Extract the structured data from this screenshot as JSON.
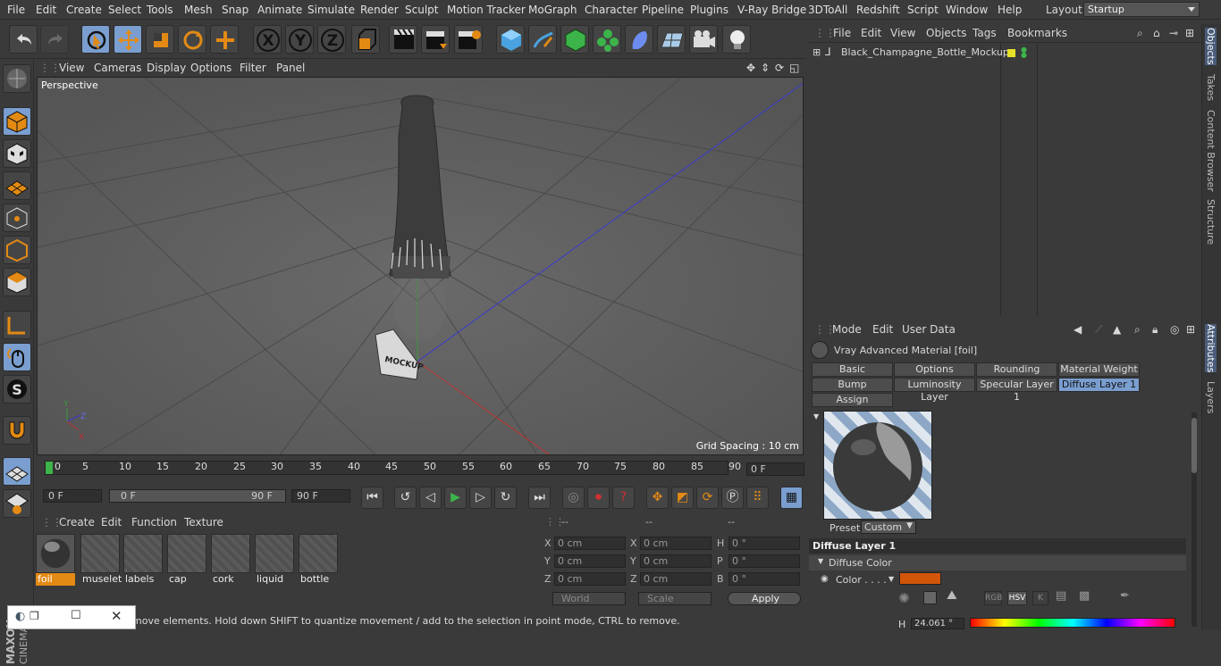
{
  "menu": [
    "File",
    "Edit",
    "Create",
    "Select",
    "Tools",
    "Mesh",
    "Snap",
    "Animate",
    "Simulate",
    "Render",
    "Sculpt",
    "Motion Tracker",
    "MoGraph",
    "Character",
    "Pipeline",
    "Plugins",
    "V-Ray Bridge",
    "3DToAll",
    "Redshift",
    "Script",
    "Window",
    "Help"
  ],
  "layout": {
    "label": "Layout:",
    "value": "Startup"
  },
  "toolbar_icons": [
    "undo-icon",
    "redo-icon",
    "live-selection-icon",
    "move-icon",
    "scale-icon",
    "rotate-icon",
    "last-tool-icon",
    "x-axis-icon",
    "y-axis-icon",
    "z-axis-icon",
    "coordinate-system-icon",
    "render-view-icon",
    "render-picture-viewer-icon",
    "edit-render-settings-icon",
    "cube-icon",
    "pen-icon",
    "subdivision-icon",
    "cloner-icon",
    "deformer-icon",
    "floor-icon",
    "camera-icon",
    "light-icon"
  ],
  "viewport_menu": [
    "View",
    "Cameras",
    "Display",
    "Options",
    "Filter",
    "Panel"
  ],
  "viewport": {
    "label": "Perspective",
    "grid_spacing": "Grid Spacing : 10 cm",
    "bottle_label": "MOCKUP"
  },
  "timeline": {
    "ticks": [
      "0",
      "5",
      "10",
      "15",
      "20",
      "25",
      "30",
      "35",
      "40",
      "45",
      "50",
      "55",
      "60",
      "65",
      "70",
      "75",
      "80",
      "85",
      "90"
    ],
    "current_frame": "0 F"
  },
  "transport": {
    "start": "0 F",
    "range_start": "0 F",
    "range_end": "90 F",
    "end": "90 F"
  },
  "material_manager": {
    "menu": [
      "Create",
      "Edit",
      "Function",
      "Texture"
    ],
    "materials": [
      "foil",
      "muselet",
      "labels",
      "cap",
      "cork",
      "liquid",
      "bottle"
    ],
    "selected": "foil"
  },
  "coords": {
    "headers": [
      "--",
      "--",
      "--"
    ],
    "rows": [
      {
        "a": "X",
        "av": "0 cm",
        "b": "X",
        "bv": "0 cm",
        "c": "H",
        "cv": "0 °"
      },
      {
        "a": "Y",
        "av": "0 cm",
        "b": "Y",
        "bv": "0 cm",
        "c": "P",
        "cv": "0 °"
      },
      {
        "a": "Z",
        "av": "0 cm",
        "b": "Z",
        "bv": "0 cm",
        "c": "B",
        "cv": "0 °"
      }
    ],
    "mode1": "World",
    "mode2": "Scale",
    "apply": "Apply"
  },
  "status": "move elements. Hold down SHIFT to quantize movement / add to the selection in point mode, CTRL to remove.",
  "object_manager": {
    "menu": [
      "File",
      "Edit",
      "View",
      "Objects",
      "Tags",
      "Bookmarks"
    ],
    "object": "Black_Champagne_Bottle_Mockup"
  },
  "attributes": {
    "menu": [
      "Mode",
      "Edit",
      "User Data"
    ],
    "title": "Vray Advanced Material [foil]",
    "tabs_row1": [
      "Basic",
      "Options",
      "Rounding",
      "Material Weight"
    ],
    "tabs_row2": [
      "Bump",
      "Luminosity Layer",
      "Specular Layer 1",
      "Diffuse Layer 1"
    ],
    "tabs_row3": [
      "Assign"
    ],
    "preset_label": "Preset",
    "preset_value": "Custom",
    "section": "Diffuse Layer 1",
    "group": "Diffuse Color",
    "color_label": "Color . . . .",
    "color_value": "#d2550a",
    "h_label": "H",
    "h_value": "24.061 °",
    "color_modes": [
      "RGB",
      "HSV",
      "K"
    ]
  },
  "right_tabs": [
    "Objects",
    "Takes",
    "Content Browser",
    "Structure",
    "Attributes",
    "Layers"
  ],
  "colors": {
    "accent": "#7a9ecf",
    "orange": "#e38a14"
  }
}
